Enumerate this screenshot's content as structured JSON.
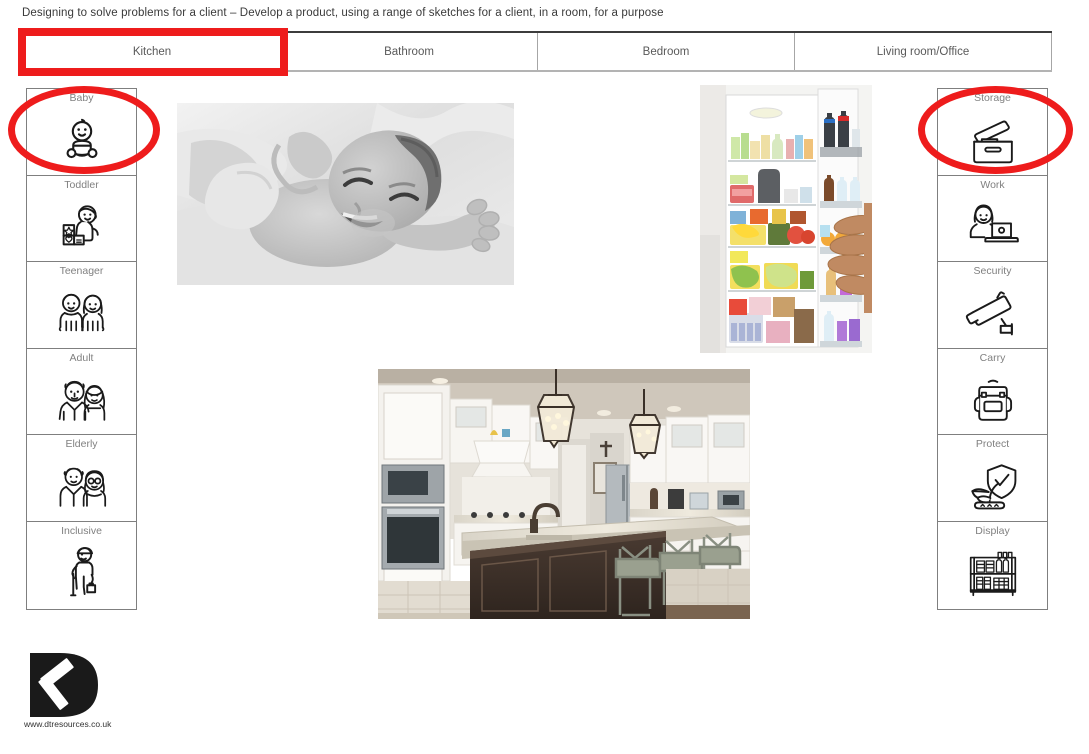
{
  "page": {
    "title": "Designing to solve problems for a client – Develop a product, using a range of sketches for a client, in a room, for a purpose",
    "accent_red": "#ee1c1c",
    "label_gray": "#808080",
    "border_gray": "#7f7f7f"
  },
  "tabs": [
    {
      "label": "Kitchen",
      "selected": true
    },
    {
      "label": "Bathroom",
      "selected": false
    },
    {
      "label": "Bedroom",
      "selected": false
    },
    {
      "label": "Living room/Office",
      "selected": false
    }
  ],
  "left_sidebar": {
    "name": "user-groups",
    "items": [
      {
        "label": "Baby",
        "icon": "baby-icon",
        "highlighted": true
      },
      {
        "label": "Toddler",
        "icon": "toddler-icon",
        "highlighted": false
      },
      {
        "label": "Teenager",
        "icon": "teenager-icon",
        "highlighted": false
      },
      {
        "label": "Adult",
        "icon": "adult-icon",
        "highlighted": false
      },
      {
        "label": "Elderly",
        "icon": "elderly-icon",
        "highlighted": false
      },
      {
        "label": "Inclusive",
        "icon": "inclusive-icon",
        "highlighted": false
      }
    ]
  },
  "right_sidebar": {
    "name": "product-purposes",
    "items": [
      {
        "label": "Storage",
        "icon": "storage-box-icon",
        "highlighted": true
      },
      {
        "label": "Work",
        "icon": "work-laptop-icon",
        "highlighted": false
      },
      {
        "label": "Security",
        "icon": "security-camera-icon",
        "highlighted": false
      },
      {
        "label": "Carry",
        "icon": "carry-backpack-icon",
        "highlighted": false
      },
      {
        "label": "Protect",
        "icon": "protect-shield-icon",
        "highlighted": false
      },
      {
        "label": "Display",
        "icon": "display-shelf-icon",
        "highlighted": false
      }
    ]
  },
  "photos": [
    {
      "name": "baby-photo",
      "description": "Black and white photograph of a smiling newborn baby lying on a soft blanket"
    },
    {
      "name": "fridge-photo",
      "description": "Open refrigerator stocked with food and drinks, a hand on the door"
    },
    {
      "name": "kitchen-photo",
      "description": "Modern white kitchen with dark wood island, granite worktop, lantern pendant lights and bar stools"
    }
  ],
  "footer": {
    "logo_name": "dt-resources-logo",
    "url": "www.dtresources.co.uk"
  },
  "annotations": [
    {
      "name": "red-box-kitchen-tab",
      "shape": "rectangle",
      "target": "Kitchen"
    },
    {
      "name": "red-ellipse-baby",
      "shape": "ellipse",
      "target": "Baby"
    },
    {
      "name": "red-ellipse-storage",
      "shape": "ellipse",
      "target": "Storage"
    }
  ]
}
